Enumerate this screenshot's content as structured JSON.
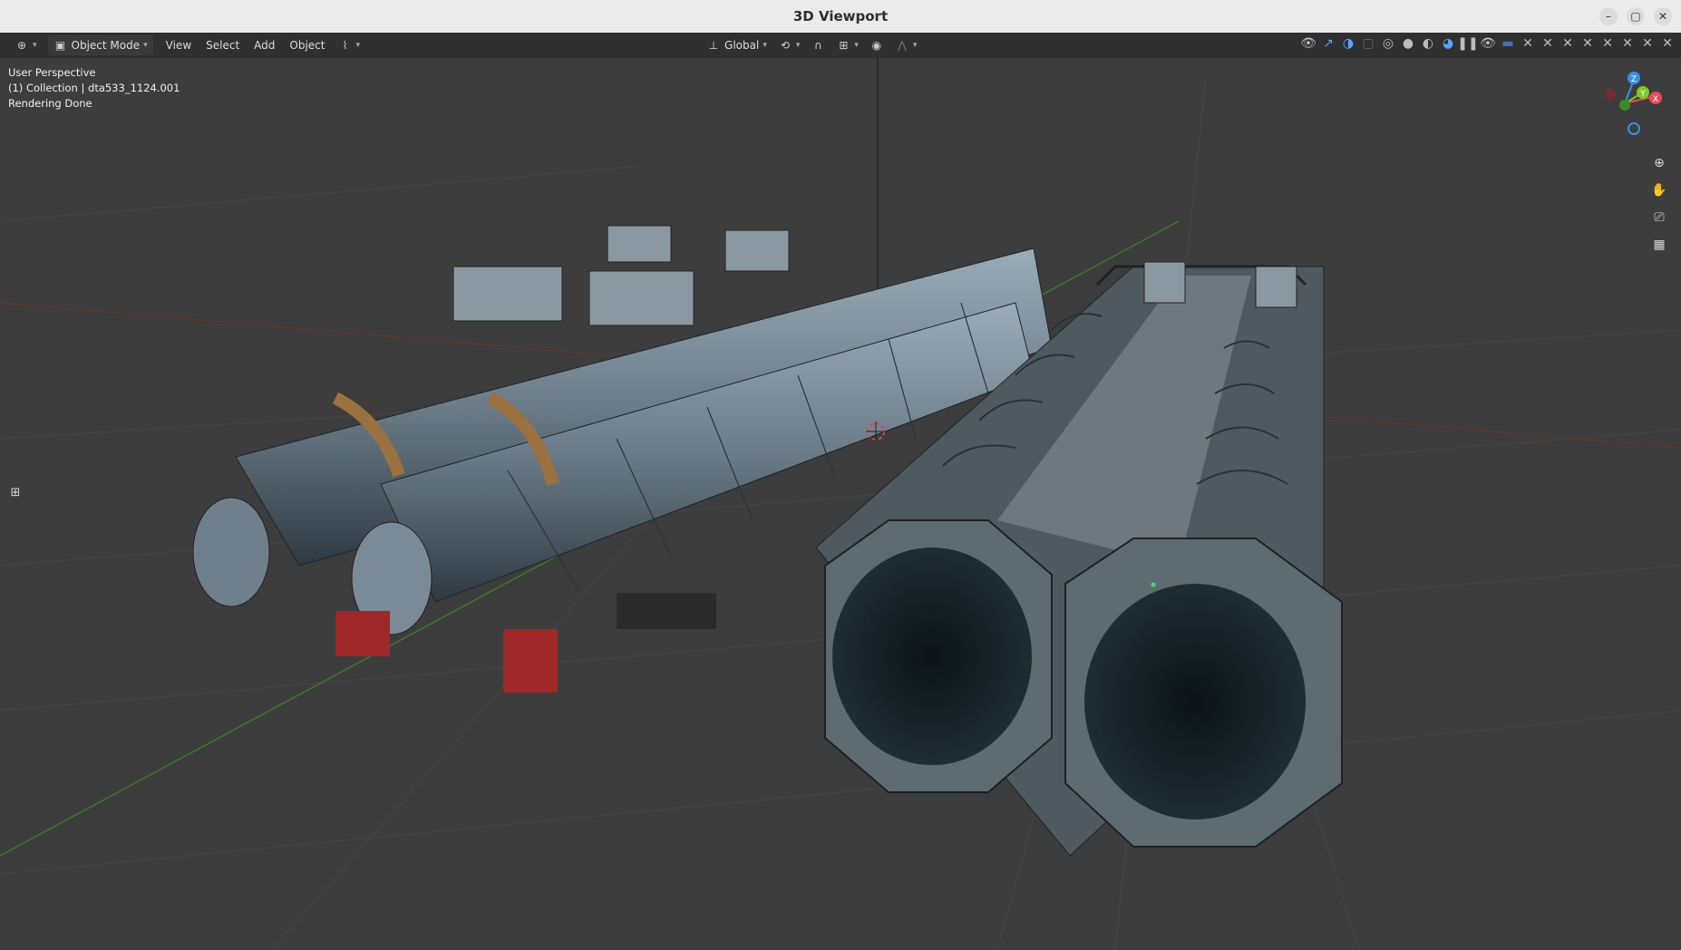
{
  "window": {
    "title": "3D Viewport",
    "controls": [
      "–",
      "▢",
      "✕"
    ]
  },
  "header": {
    "editor_type_icon": "editor-type-icon",
    "mode": "Object Mode",
    "menus": [
      "View",
      "Select",
      "Add",
      "Object"
    ],
    "transform_orientation": "Global"
  },
  "overlay": {
    "line1": "User Perspective",
    "line2": "(1) Collection | dta533_1124.001",
    "line3": "Rendering Done"
  },
  "gizmo": {
    "z": "Z",
    "y": "Y",
    "x": "X"
  },
  "colors": {
    "axis_x": "#e84a5f",
    "axis_y": "#7ec829",
    "axis_z": "#3b8eea",
    "accent": "#4772b3"
  }
}
